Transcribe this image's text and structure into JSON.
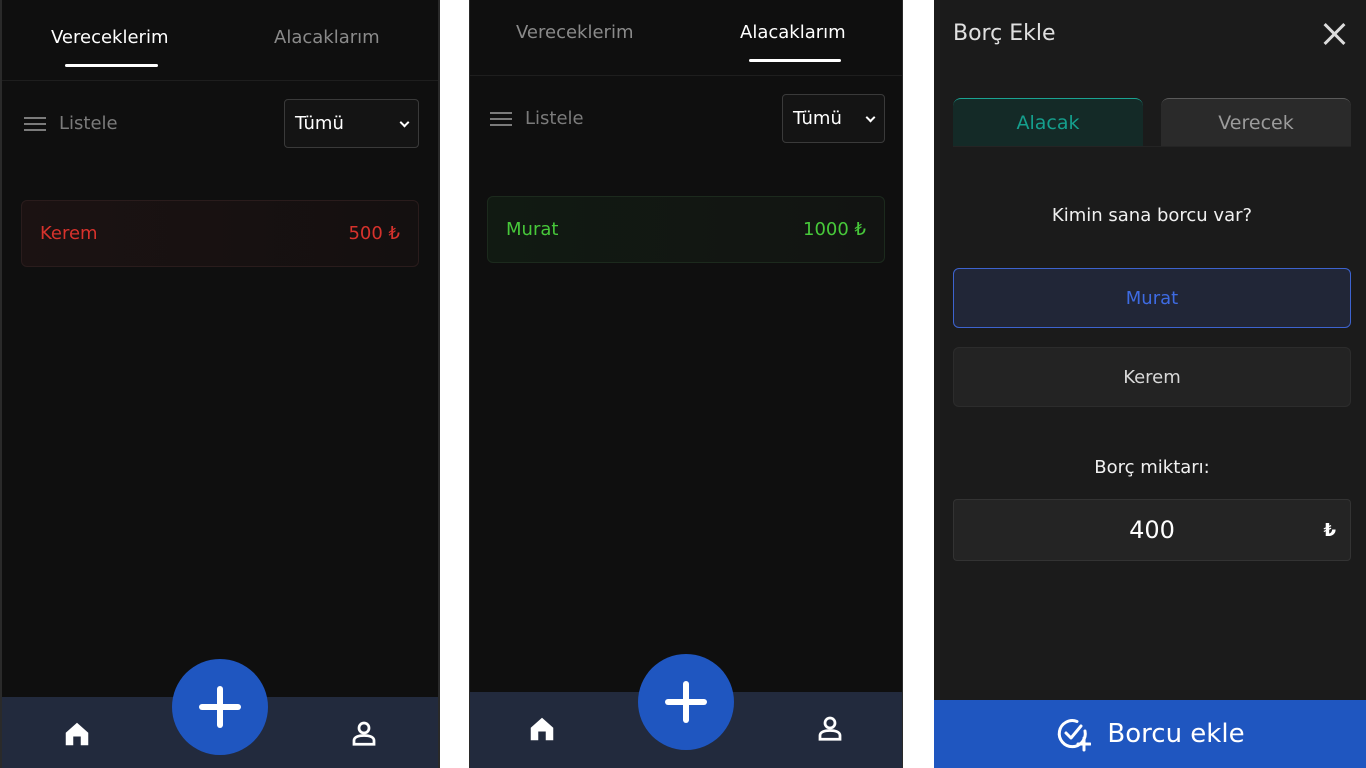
{
  "screens": [
    {
      "tabs": [
        "Vereceklerim",
        "Alacaklarım"
      ],
      "listele": "Listele",
      "filter": "Tümü",
      "entries": [
        {
          "name": "Kerem",
          "amount": "500 ₺"
        }
      ]
    },
    {
      "tabs": [
        "Vereceklerim",
        "Alacaklarım"
      ],
      "listele": "Listele",
      "filter": "Tümü",
      "entries": [
        {
          "name": "Murat",
          "amount": "1000 ₺"
        }
      ]
    }
  ],
  "dialog": {
    "title": "Borç Ekle",
    "tabs": [
      "Alacak",
      "Verecek"
    ],
    "question": "Kimin sana borcu var?",
    "people": [
      "Murat",
      "Kerem"
    ],
    "amount_label": "Borç miktarı:",
    "amount_value": "400",
    "currency": "₺",
    "submit": "Borcu ekle"
  },
  "colors": {
    "background": "#0f0f0f",
    "nav": "#222a3d",
    "accent_blue": "#1f56c0",
    "debt_red": "#d7322c",
    "credit_green": "#47c83a",
    "teal": "#159f8d"
  },
  "icons": [
    "list-icon",
    "chevron-down-icon",
    "home-icon",
    "plus-icon",
    "user-icon",
    "close-icon",
    "check-circle-plus-icon"
  ]
}
